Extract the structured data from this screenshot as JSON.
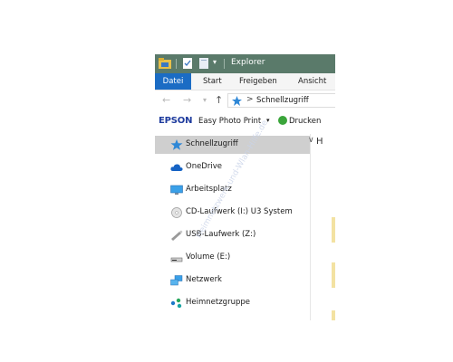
{
  "window": {
    "title": "Explorer"
  },
  "ribbon": {
    "tabs": [
      {
        "label": "Datei",
        "active": true
      },
      {
        "label": "Start",
        "active": false
      },
      {
        "label": "Freigeben",
        "active": false
      },
      {
        "label": "Ansicht",
        "active": false
      }
    ]
  },
  "address": {
    "separator": ">",
    "current": "Schnellzugriff"
  },
  "epson_toolbar": {
    "logo": "EPSON",
    "app": "Easy Photo Print",
    "dropdown": "▾",
    "print_label": "Drucken"
  },
  "nav_pane": {
    "items": [
      {
        "label": "Schnellzugriff",
        "icon": "star-icon",
        "selected": true
      },
      {
        "label": "OneDrive",
        "icon": "cloud-icon",
        "selected": false
      },
      {
        "label": "Arbeitsplatz",
        "icon": "monitor-icon",
        "selected": false
      },
      {
        "label": "CD-Laufwerk (I:) U3 System",
        "icon": "cd-icon",
        "selected": false
      },
      {
        "label": "USB-Laufwerk (Z:)",
        "icon": "usb-drive-icon",
        "selected": false
      },
      {
        "label": "Volume (E:)",
        "icon": "drive-icon",
        "selected": false
      },
      {
        "label": "Netzwerk",
        "icon": "network-icon",
        "selected": false
      },
      {
        "label": "Heimnetzgruppe",
        "icon": "homegroup-icon",
        "selected": false
      }
    ]
  },
  "content": {
    "header": "H"
  },
  "watermark": "Heimnetzwerk-und-Wlan-Hilfe.de",
  "colors": {
    "titlebar": "#5a7a6a",
    "active_tab": "#1b6cc4",
    "selection": "#cfcfcf",
    "epson_logo": "#1f3c9e"
  }
}
